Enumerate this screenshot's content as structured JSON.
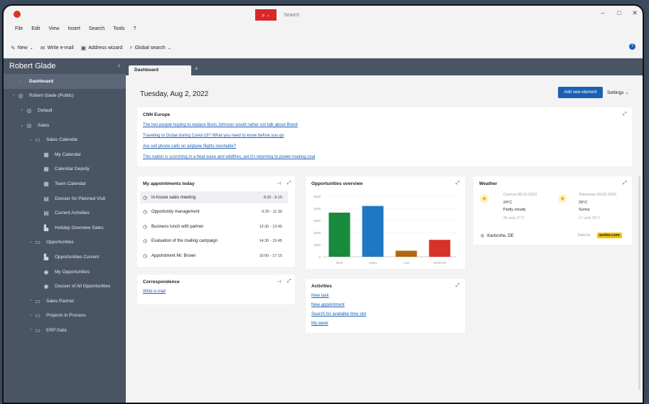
{
  "search": {
    "placeholder": "Search"
  },
  "window_controls": [
    "–",
    "□",
    "✕"
  ],
  "menu": [
    "File",
    "Edit",
    "View",
    "Insert",
    "Search",
    "Tools",
    "?"
  ],
  "toolbar": {
    "new_label": "New",
    "write_email_label": "Write e-mail",
    "address_wizard_label": "Address wizard",
    "global_search_label": "Global search"
  },
  "sidebar": {
    "title": "Robert Glade",
    "items": [
      {
        "label": "Dashboard",
        "indent": 0,
        "arrow": "",
        "icon": "⌂",
        "active": true
      },
      {
        "label": "Robert Glade (Public)",
        "indent": 0,
        "arrow": "›",
        "icon": "◎"
      },
      {
        "label": "Default",
        "indent": 1,
        "arrow": "›",
        "icon": "◎"
      },
      {
        "label": "Sales",
        "indent": 1,
        "arrow": "⌄",
        "icon": "◎"
      },
      {
        "label": "Sales Calendar",
        "indent": 2,
        "arrow": "›",
        "icon": "▭"
      },
      {
        "label": "My Calendar",
        "indent": 3,
        "arrow": "",
        "icon": "▦"
      },
      {
        "label": "Calendar Deputy",
        "indent": 3,
        "arrow": "",
        "icon": "▦"
      },
      {
        "label": "Team Calendar",
        "indent": 3,
        "arrow": "",
        "icon": "▦"
      },
      {
        "label": "Dossier for Planned Visit",
        "indent": 3,
        "arrow": "",
        "icon": "▤"
      },
      {
        "label": "Current Activities",
        "indent": 3,
        "arrow": "",
        "icon": "▤"
      },
      {
        "label": "Holiday Overview Sales",
        "indent": 3,
        "arrow": "",
        "icon": "▙"
      },
      {
        "label": "Opportunities",
        "indent": 2,
        "arrow": "›",
        "icon": "▭"
      },
      {
        "label": "Opportunities Current",
        "indent": 3,
        "arrow": "",
        "icon": "▙"
      },
      {
        "label": "My Opportunities",
        "indent": 3,
        "arrow": "",
        "icon": "◉"
      },
      {
        "label": "Dossier of All Opportunities",
        "indent": 3,
        "arrow": "",
        "icon": "◉"
      },
      {
        "label": "Sales Partner",
        "indent": 2,
        "arrow": "›",
        "icon": "▭"
      },
      {
        "label": "Projects in Process",
        "indent": 2,
        "arrow": "›",
        "icon": "▭"
      },
      {
        "label": "ERP Data",
        "indent": 2,
        "arrow": "›",
        "icon": "▭"
      }
    ]
  },
  "tabs": [
    {
      "label": "Dashboard"
    }
  ],
  "tab_add": "+",
  "dashboard": {
    "date": "Tuesday, Aug 2, 2022",
    "add_element_label": "Add new element",
    "settings_label": "Settings"
  },
  "cnn": {
    "title": "CNN Europe",
    "links": [
      "The two people hoping to replace Boris Johnson would rather not talk about Brexit",
      "Traveling to Dubai during Covid-19? What you need to know before you go",
      "Are cell phone calls on airplane flights inevitable?",
      "This nation is scorching in a heat wave and wildfires, yet it's returning to power-making coal"
    ]
  },
  "appointments": {
    "title": "My appointments today",
    "rows": [
      {
        "title": "In-house sales meeting",
        "time": "8:30 - 9:15",
        "selected": true
      },
      {
        "title": "Opportunity management",
        "time": "9:30 - 11:30"
      },
      {
        "title": "Business lunch with partner",
        "time": "12:30 - 13:45"
      },
      {
        "title": "Evaluation of the mailing campaign",
        "time": "14:30 - 15:45"
      },
      {
        "title": "Appointment Mr. Brown",
        "time": "16:00 - 17:15"
      }
    ]
  },
  "correspondence": {
    "title": "Correspondence",
    "link": "Write e-mail"
  },
  "chart_data": {
    "type": "bar",
    "title": "Opportunities overview",
    "categories": [
      "Won",
      "Open",
      "Lost",
      "Deferred"
    ],
    "values": [
      3650,
      4200,
      500,
      1400
    ],
    "colors": [
      "#178a3c",
      "#1f78c1",
      "#b5650d",
      "#d63229"
    ],
    "yticks": [
      "0",
      "1000",
      "2000",
      "3000",
      "4000",
      "5000"
    ],
    "ylim": [
      0,
      5000
    ]
  },
  "activities": {
    "title": "Activities",
    "links": [
      "New task",
      "New appointment",
      "Search for available time slot",
      "My week"
    ]
  },
  "weather": {
    "title": "Weather",
    "days": [
      {
        "date": "Current 08.02.2022",
        "temp": "24°C",
        "desc": "Partly cloudy",
        "extra": "36 units 27°C"
      },
      {
        "date": "Tomorrow 09.02.2022",
        "temp": "29°C",
        "desc": "Sunny",
        "extra": "17 units 30°C"
      }
    ],
    "location": "Karlsruhe, DE",
    "provider_label": "Data by",
    "provider_brand": "wetter.com"
  }
}
